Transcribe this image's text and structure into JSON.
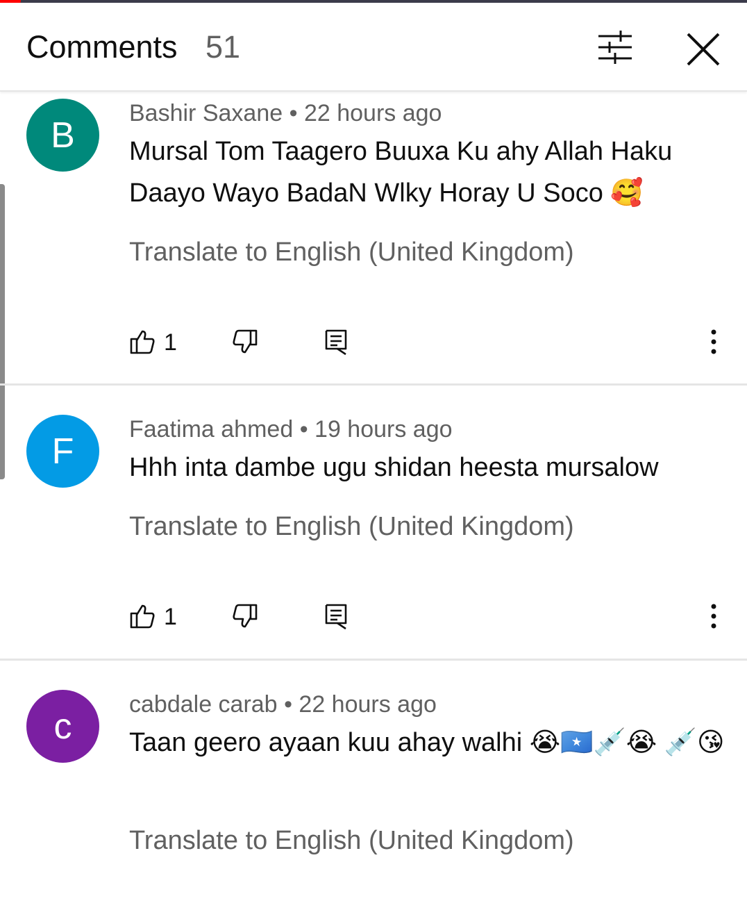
{
  "header": {
    "title": "Comments",
    "count": "51"
  },
  "colors": {
    "avatar_b": "#00897b",
    "avatar_f": "#039be5",
    "avatar_c": "#7b1fa2",
    "secondary_text": "#606060"
  },
  "icons": {
    "filter": "sort-filter-icon",
    "close": "close-icon",
    "like": "thumbs-up-icon",
    "dislike": "thumbs-down-icon",
    "reply": "reply-icon",
    "more": "more-vertical-icon"
  },
  "comments": [
    {
      "avatar_letter": "B",
      "author": "Bashir Saxane",
      "separator": "•",
      "time": "22 hours ago",
      "text": "Mursal Tom Taagero Buuxa Ku ahy Allah Haku Daayo Wayo BadaN Wlky Horay U Soco 🥰",
      "translate": "Translate to English (United Kingdom)",
      "likes": "1"
    },
    {
      "avatar_letter": "F",
      "author": "Faatima ahmed",
      "separator": "•",
      "time": "19 hours ago",
      "text": "Hhh inta dambe ugu shidan heesta mursalow",
      "translate": "Translate to English (United Kingdom)",
      "likes": "1"
    },
    {
      "avatar_letter": "c",
      "author": "cabdale carab",
      "separator": "•",
      "time": "22 hours ago",
      "text": "Taan geero ayaan kuu ahay walhi 😭🇸🇴💉😭 💉😘",
      "translate": "Translate to English (United Kingdom)"
    }
  ]
}
